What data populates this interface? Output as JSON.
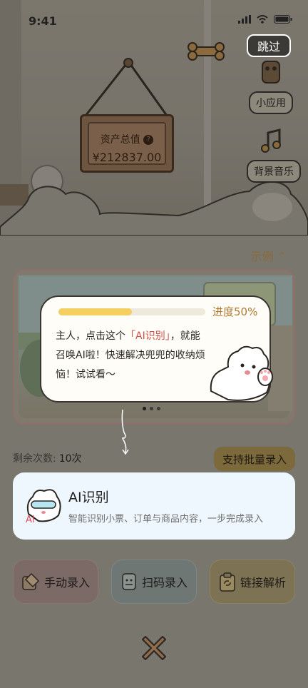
{
  "status_bar": {
    "time": "9:41"
  },
  "header": {
    "skip_label": "跳过"
  },
  "side_buttons": [
    {
      "label": "小应用",
      "icon": "puppy-pair-icon"
    },
    {
      "label": "背景音乐",
      "icon": "music-note-icon"
    }
  ],
  "sign": {
    "asset_label": "资产总值",
    "asset_value": "¥212837.00"
  },
  "examples": {
    "toggle_label": "示例"
  },
  "carousel": {
    "page_count": 3,
    "active_index": 0
  },
  "tooltip": {
    "progress_fraction": 0.5,
    "progress_label": "进度50%",
    "line_prefix": "主人，点击这个",
    "highlight": "「AI识别」",
    "line_suffix": "，就能召唤AI啦！快速解决兜兜的收纳烦恼！试试看～"
  },
  "quota": {
    "label": "剩余次数:",
    "value": "10次"
  },
  "batch_button": {
    "label": "支持批量录入"
  },
  "ai_card": {
    "title": "AI识别",
    "description": "智能识别小票、订单与商品内容，一步完成录入",
    "badge": "Ai"
  },
  "actions": [
    {
      "label": "手动录入",
      "icon": "pen-note-icon"
    },
    {
      "label": "扫码录入",
      "icon": "scan-icon"
    },
    {
      "label": "链接解析",
      "icon": "clipboard-link-icon"
    }
  ],
  "colors": {
    "accent": "#f5cf62",
    "highlight_text": "#d34f4a",
    "progress_text": "#b07a34",
    "ai_card_bg": "#eef7fd"
  }
}
